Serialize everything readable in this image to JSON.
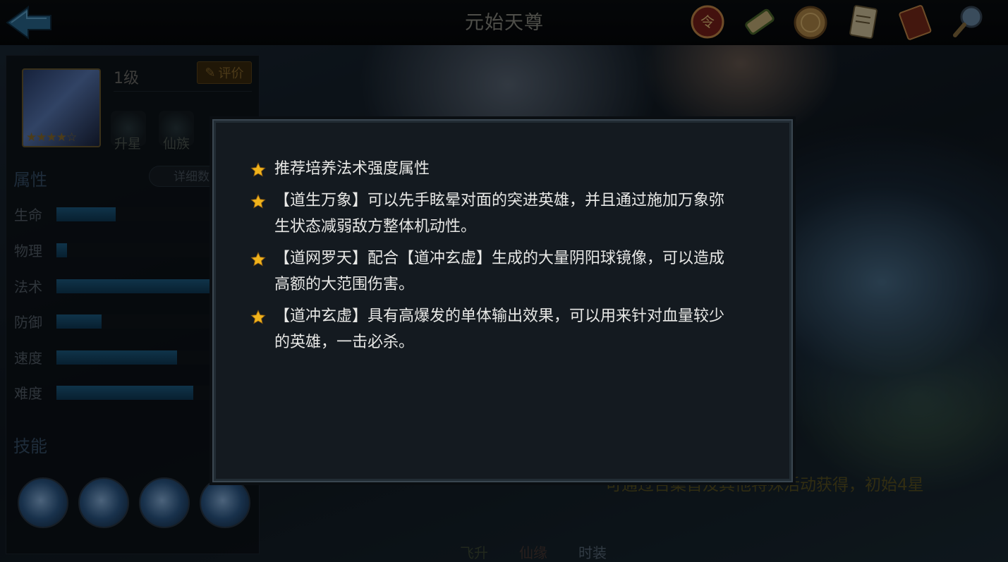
{
  "header": {
    "title": "元始天尊",
    "icons": [
      "seal-icon",
      "scroll-icon",
      "coin-icon",
      "paper-icon",
      "book-icon",
      "magnifier-icon"
    ]
  },
  "hero": {
    "level": "1级",
    "rate_label": "评价",
    "star_count": 4,
    "emblems": [
      "升星",
      "仙族"
    ]
  },
  "attributes": {
    "title": "属性",
    "detail_label": "详细数",
    "items": [
      {
        "label": "生命",
        "level": 0.29
      },
      {
        "label": "物理",
        "level": 0.05
      },
      {
        "label": "法术",
        "level": 0.76
      },
      {
        "label": "防御",
        "level": 0.22
      },
      {
        "label": "速度",
        "level": 0.59
      },
      {
        "label": "难度",
        "level": 0.67
      }
    ]
  },
  "skills": {
    "title": "技能"
  },
  "bottom_tabs": [
    {
      "label": "飞升",
      "color": "#3d5a2a"
    },
    {
      "label": "仙缘",
      "color": "#5a2a2a"
    },
    {
      "label": "时装",
      "color": "#24466a"
    }
  ],
  "caption": "可通过召集首及其他特殊活动获得，初始4星",
  "tips": [
    "推荐培养法术强度属性",
    "【道生万象】可以先手眩晕对面的突进英雄，并且通过施加万象弥生状态减弱敌方整体机动性。",
    "【道网罗天】配合【道冲玄虚】生成的大量阴阳球镜像，可以造成高额的大范围伤害。",
    "【道冲玄虚】具有高爆发的单体输出效果，可以用来针对血量较少的英雄，一击必杀。"
  ],
  "colors": {
    "star": "#f0b31c",
    "accent": "#1d5e86"
  }
}
